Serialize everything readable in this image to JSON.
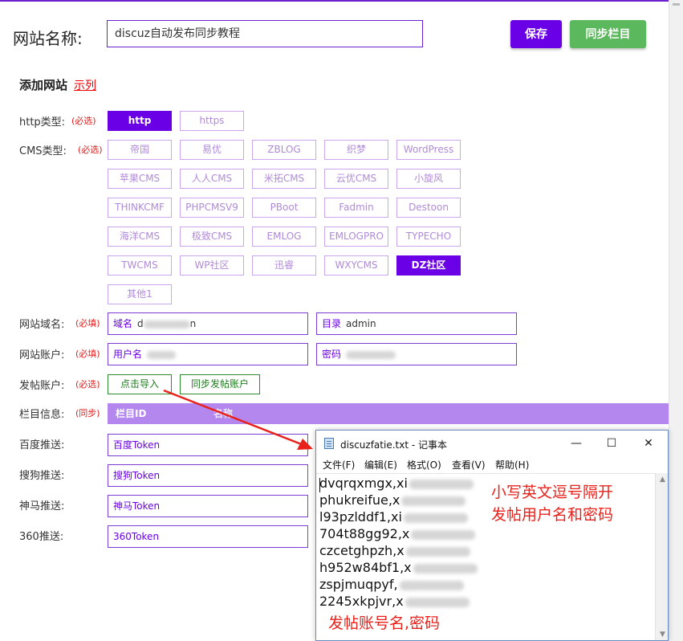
{
  "header": {
    "site_name_label": "网站名称:",
    "site_name_value": "discuz自动发布同步教程",
    "save_label": "保存",
    "sync_categories_label": "同步栏目"
  },
  "add_site": {
    "title": "添加网站",
    "example_link": "示列"
  },
  "rows": {
    "http_type": {
      "label": "http类型:",
      "req": "(必选)",
      "options": [
        "http",
        "https"
      ],
      "selected": "http"
    },
    "cms_type": {
      "label": "CMS类型:",
      "req": "(必选)",
      "options": [
        "帝国",
        "易优",
        "ZBLOG",
        "织梦",
        "WordPress",
        "苹果CMS",
        "人人CMS",
        "米拓CMS",
        "云优CMS",
        "小旋风",
        "THINKCMF",
        "PHPCMSV9",
        "PBoot",
        "Fadmin",
        "Destoon",
        "海洋CMS",
        "极致CMS",
        "EMLOG",
        "EMLOGPRO",
        "TYPECHO",
        "TWCMS",
        "WP社区",
        "迅睿",
        "WXYCMS",
        "DZ社区",
        "其他1"
      ],
      "selected": "DZ社区"
    },
    "domain": {
      "label": "网站域名:",
      "req": "(必填)",
      "domain_label": "域名",
      "domain_value": "d",
      "domain_suffix": "n",
      "dir_label": "目录",
      "dir_value": "admin"
    },
    "account": {
      "label": "网站账户:",
      "req": "(必填)",
      "user_label": "用户名",
      "pass_label": "密码"
    },
    "post_account": {
      "label": "发帖账户:",
      "req": "(必选)",
      "import_label": "点击导入",
      "sync_label": "同步发帖账户"
    },
    "category": {
      "label": "栏目信息:",
      "req": "(同步)",
      "col_id": "栏目ID",
      "col_name": "名称"
    },
    "baidu": {
      "label": "百度推送:",
      "placeholder": "百度Token"
    },
    "sogou": {
      "label": "搜狗推送:",
      "placeholder": "搜狗Token"
    },
    "shenma": {
      "label": "神马推送:",
      "placeholder": "神马Token"
    },
    "s360": {
      "label": "360推送:",
      "placeholder": "360Token"
    }
  },
  "notepad": {
    "title": "discuzfatie.txt - 记事本",
    "menu": [
      "文件(F)",
      "编辑(E)",
      "格式(O)",
      "查看(V)",
      "帮助(H)"
    ],
    "lines": [
      "dvqrqxmgx,xi",
      "phukreifue,x",
      "l93pzlddf1,xi",
      "704t88gg92,x",
      "czcetghpzh,x",
      "h952w84bf1,x",
      "zspjmuqpyf,",
      "2245xkpjvr,x"
    ]
  },
  "annotations": {
    "note1_line1": "小写英文逗号隔开",
    "note1_line2": "发帖用户名和密码",
    "note2": "发帖账号名,密码"
  },
  "colors": {
    "accent": "#6a00e6",
    "green": "#5cb85c",
    "red_note": "#e8221b"
  }
}
